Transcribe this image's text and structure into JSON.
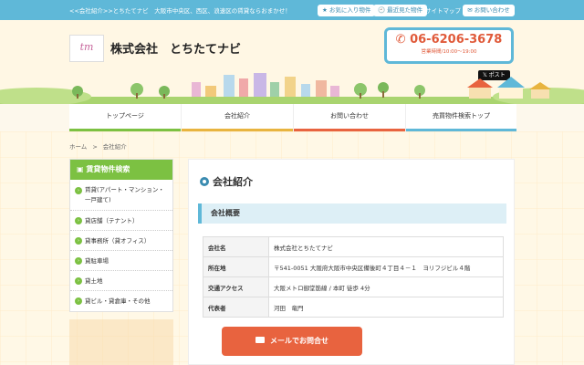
{
  "topbar": {
    "tagline": "<<会社紹介>>とちたてナビ　大阪市中央区、西区、浪速区の賃貸ならおまかせ！",
    "favorites_label": "★ お気に入り物件",
    "recent_label": "🕘 最近見た物件",
    "sitemap_label": "サイトマップ",
    "contact_label": "✉ お問い合わせ"
  },
  "header": {
    "logo_text": "tm",
    "company_name": "株式会社　とちたてナビ",
    "phone": "06-6206-3678",
    "hours": "営業時間/10:00〜19:00",
    "post_label": "𝕏 ポスト"
  },
  "nav": {
    "items": [
      {
        "label": "トップページ",
        "color": "#7cc142"
      },
      {
        "label": "会社紹介",
        "color": "#e8b43f"
      },
      {
        "label": "お問い合わせ",
        "color": "#e8633f"
      },
      {
        "label": "売買物件検索トップ",
        "color": "#5fb8d8"
      }
    ]
  },
  "breadcrumb": {
    "home": "ホーム",
    "separator": ">",
    "current": "会社紹介"
  },
  "sidebar": {
    "title": "賃貸物件検索",
    "items": [
      {
        "label": "賃貸(アパート・マンション・一戸建て)"
      },
      {
        "label": "貸店舗（テナント）"
      },
      {
        "label": "貸事務所（貸オフィス）"
      },
      {
        "label": "貸駐車場"
      },
      {
        "label": "貸土地"
      },
      {
        "label": "貸ビル・貸倉庫・その他"
      }
    ]
  },
  "main": {
    "title": "会社紹介",
    "section_title": "会社概要",
    "rows": [
      {
        "key": "会社名",
        "value": "株式会社とちたてナビ"
      },
      {
        "key": "所在地",
        "value": "〒541-0051 大阪府大阪市中央区備後町４丁目４－１　ヨリフジビル４階"
      },
      {
        "key": "交通アクセス",
        "value": "大阪メトロ御堂筋線 / 本町 徒歩 4分"
      },
      {
        "key": "代表者",
        "value": "河田　竜門"
      }
    ]
  },
  "mail_button": {
    "label": "メールでお問合せ"
  },
  "colors": {
    "topbar": "#5fb8d8",
    "accent_green": "#7cc142",
    "mail_orange": "#e8633f",
    "phone_red": "#e05a3a"
  }
}
